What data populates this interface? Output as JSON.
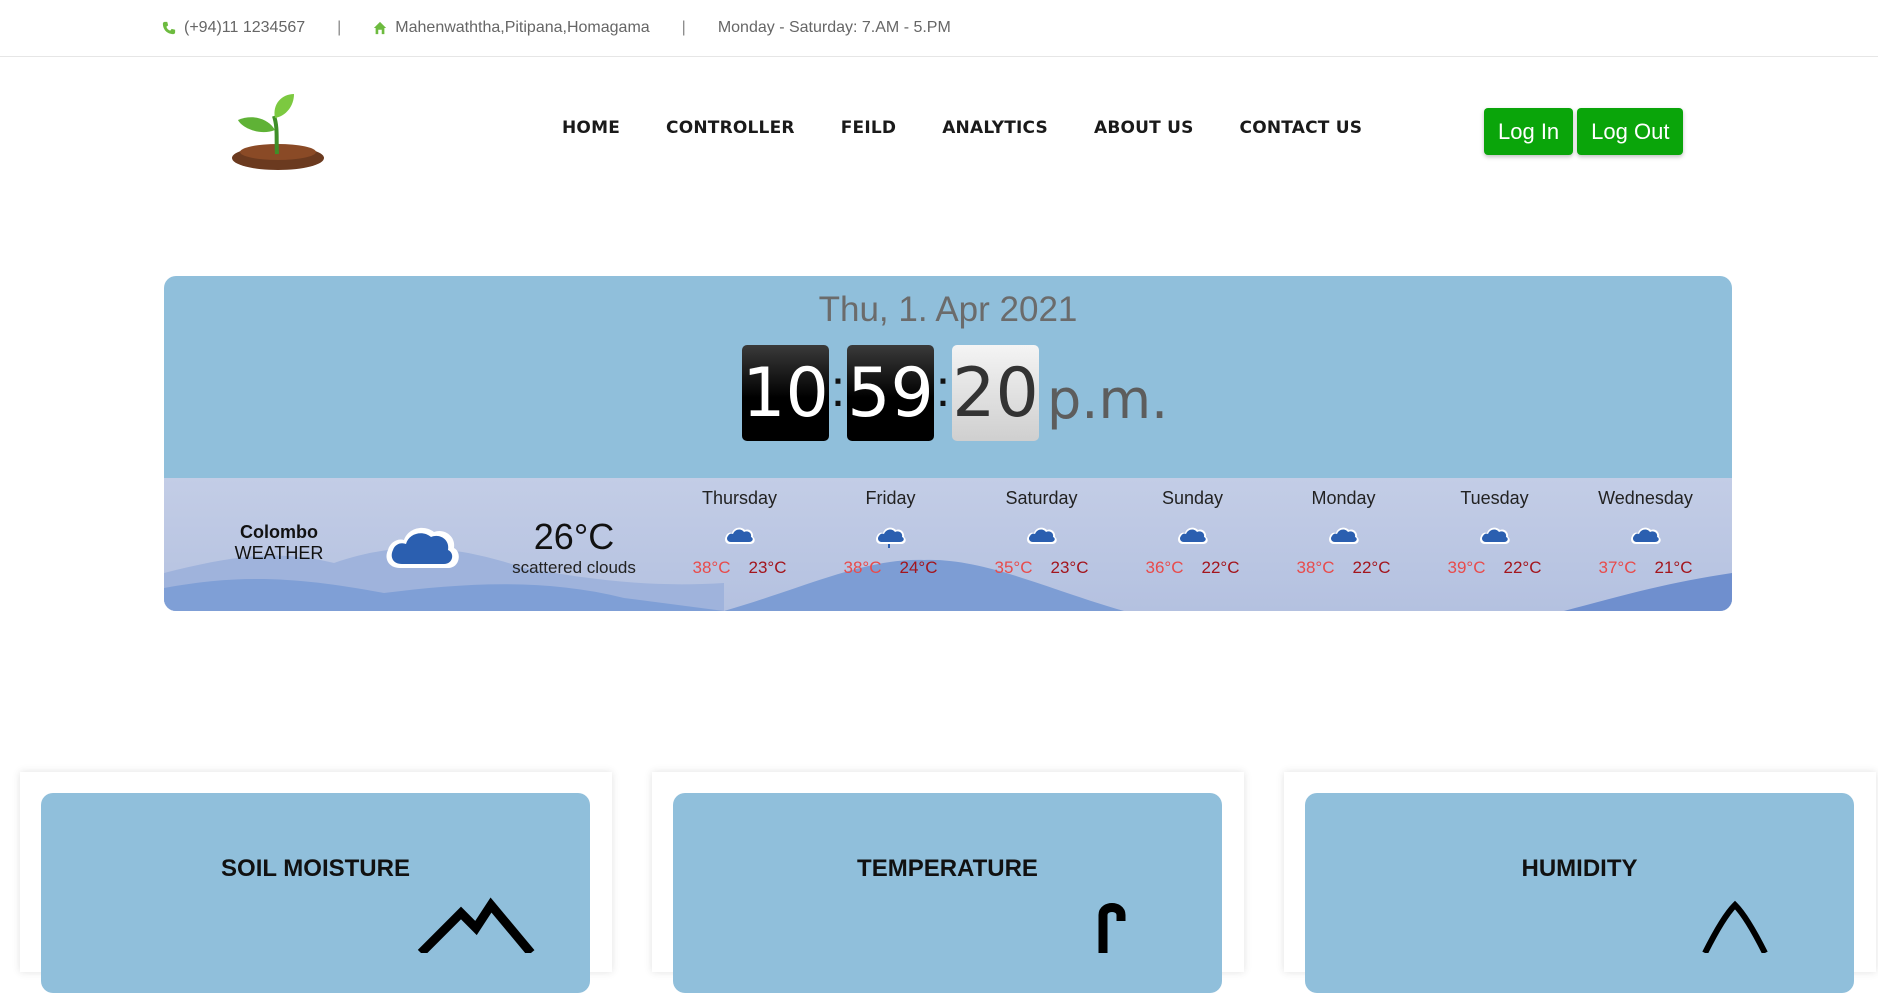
{
  "topbar": {
    "phone": "(+94)11 1234567",
    "address": "Mahenwaththa,Pitipana,Homagama",
    "hours": "Monday - Saturday: 7.AM - 5.PM",
    "separator": "|"
  },
  "nav": {
    "items": [
      "HOME",
      "CONTROLLER",
      "FEILD",
      "ANALYTICS",
      "ABOUT US",
      "CONTACT US"
    ]
  },
  "auth": {
    "login": "Log In",
    "logout": "Log Out"
  },
  "clock": {
    "date": "Thu, 1. Apr 2021",
    "hours": "10",
    "minutes": "59",
    "seconds": "20",
    "ampm": "p.m."
  },
  "weather": {
    "city": "Colombo",
    "label": "WEATHER",
    "temp": "26°C",
    "description": "scattered clouds",
    "icon": "cloud-icon",
    "forecast": [
      {
        "day": "Thursday",
        "hi": "38°C",
        "lo": "23°C",
        "icon": "cloud-icon"
      },
      {
        "day": "Friday",
        "hi": "38°C",
        "lo": "24°C",
        "icon": "rain-cloud-icon"
      },
      {
        "day": "Saturday",
        "hi": "35°C",
        "lo": "23°C",
        "icon": "cloud-icon"
      },
      {
        "day": "Sunday",
        "hi": "36°C",
        "lo": "22°C",
        "icon": "cloud-icon"
      },
      {
        "day": "Monday",
        "hi": "38°C",
        "lo": "22°C",
        "icon": "cloud-icon"
      },
      {
        "day": "Tuesday",
        "hi": "39°C",
        "lo": "22°C",
        "icon": "cloud-icon"
      },
      {
        "day": "Wednesday",
        "hi": "37°C",
        "lo": "21°C",
        "icon": "cloud-icon"
      }
    ]
  },
  "cards": [
    {
      "title": "SOIL MOISTURE",
      "icon": "soil-icon"
    },
    {
      "title": "TEMPERATURE",
      "icon": "thermometer-icon"
    },
    {
      "title": "HUMIDITY",
      "icon": "droplet-icon"
    }
  ],
  "colors": {
    "accent_green": "#0aa50a",
    "panel_blue": "#90bfdb",
    "icon_green": "#6dbb3f"
  }
}
